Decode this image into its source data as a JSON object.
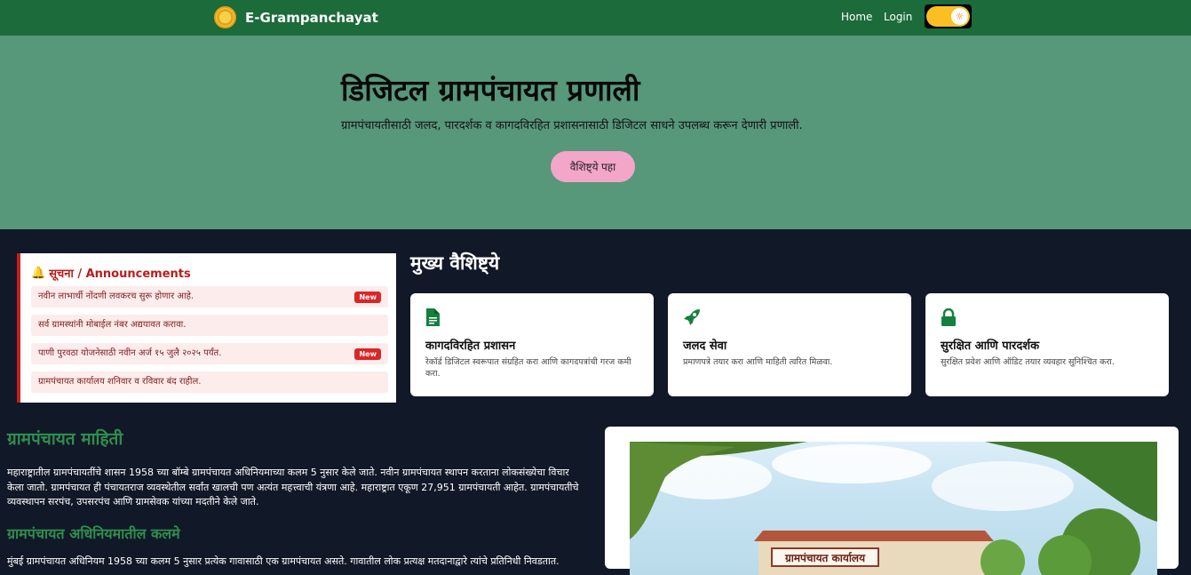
{
  "navbar": {
    "brand": "E-Grampanchayat",
    "links": [
      "Home",
      "Login"
    ],
    "theme_toggle_icon": "sun-icon"
  },
  "hero": {
    "title": "डिजिटल ग्रामपंचायत प्रणाली",
    "subtitle": "ग्रामपंचायतीसाठी जलद, पारदर्शक व कागदविरहित प्रशासनासाठी डिजिटल साधने उपलब्ध करून देणारी प्रणाली.",
    "button": "वैशिष्ट्ये पहा"
  },
  "announcements": {
    "heading": "सूचना / Announcements",
    "items": [
      {
        "text": "नवीन लाभार्थी नोंदणी लवकरच सुरू होणार आहे.",
        "badge": "New"
      },
      {
        "text": "सर्व ग्रामस्थांनी मोबाईल नंबर अद्ययावत करावा.",
        "badge": ""
      },
      {
        "text": "पाणी पुरवठा योजनेसाठी नवीन अर्ज १५ जुलै २०२५ पर्यंत.",
        "badge": "New"
      },
      {
        "text": "ग्रामपंचायत कार्यालय शनिवार व रविवार बंद राहील.",
        "badge": ""
      }
    ]
  },
  "features": {
    "title": "मुख्य वैशिष्ट्ये",
    "cards": [
      {
        "icon": "document-icon",
        "title": "कागदविरहित प्रशासन",
        "desc": "रेकॉर्ड डिजिटल स्वरूपात संग्रहित करा आणि कागदपत्रांची गरज कमी करा."
      },
      {
        "icon": "rocket-icon",
        "title": "जलद सेवा",
        "desc": "प्रमाणपत्रे तयार करा आणि माहिती त्वरित मिळवा."
      },
      {
        "icon": "lock-icon",
        "title": "सुरक्षित आणि पारदर्शक",
        "desc": "सुरक्षित प्रवेश आणि ऑडिट तयार व्यवहार सुनिश्चित करा."
      }
    ]
  },
  "info": {
    "heading1": "ग्रामपंचायत माहिती",
    "para1": "महाराष्ट्रातील ग्रामपंचायतींचे शासन 1958 च्या बॉम्बे ग्रामपंचायत अधिनियमाच्या कलम 5 नुसार केले जाते. नवीन ग्रामपंचायत स्थापन करताना लोकसंख्येचा विचार केला जातो. ग्रामपंचायत ही पंचायतराज व्यवस्थेतील सर्वांत खालची पण अत्यंत महत्त्वाची यंत्रणा आहे. महाराष्ट्रात एकूण 27,951 ग्रामपंचायती आहेत. ग्रामपंचायतीचे व्यवस्थापन सरपंच, उपसरपंच आणि ग्रामसेवक यांच्या मदतीने केले जाते.",
    "heading2": "ग्रामपंचायत अधिनियमातील कलमे",
    "para2": "मुंबई ग्रामपंचायत अधिनियम 1958 च्या कलम 5 नुसार प्रत्येक गावासाठी एक ग्रामपंचायत असते. गावातील लोक प्रत्यक्ष मतदानाद्वारे त्यांचे प्रतिनिधी निवडतात."
  },
  "image": {
    "sign_text": "ग्रामपंचायत कार्यालय"
  }
}
